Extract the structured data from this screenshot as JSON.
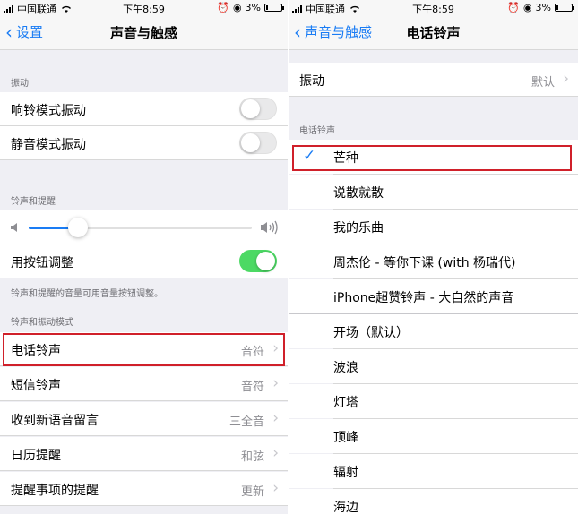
{
  "status": {
    "carrier": "中国联通",
    "time": "下午8:59",
    "battery": "3%"
  },
  "left": {
    "back_label": "设置",
    "title": "声音与触感",
    "vibration_header": "振动",
    "vibration_rows": [
      {
        "label": "响铃模式振动",
        "on": false
      },
      {
        "label": "静音模式振动",
        "on": false
      }
    ],
    "ringer_header": "铃声和提醒",
    "volume_level": 0.22,
    "buttons_row": {
      "label": "用按钮调整",
      "on": true
    },
    "buttons_footer": "铃声和提醒的音量可用音量按钮调整。",
    "patterns_header": "铃声和振动模式",
    "patterns": [
      {
        "label": "电话铃声",
        "value": "音符"
      },
      {
        "label": "短信铃声",
        "value": "音符"
      },
      {
        "label": "收到新语音留言",
        "value": "三全音"
      },
      {
        "label": "日历提醒",
        "value": "和弦"
      },
      {
        "label": "提醒事项的提醒",
        "value": "更新"
      }
    ]
  },
  "right": {
    "back_label": "声音与触感",
    "title": "电话铃声",
    "vibration_row": {
      "label": "振动",
      "value": "默认"
    },
    "ringtones_header": "电话铃声",
    "custom_tones": [
      "芒种",
      "说散就散",
      "我的乐曲",
      "周杰伦 - 等你下课 (with 杨瑞代)",
      "iPhone超赞铃声 - 大自然的声音"
    ],
    "selected_tone": "芒种",
    "builtin_tones": [
      "开场（默认）",
      "波浪",
      "灯塔",
      "顶峰",
      "辐射",
      "海边"
    ]
  },
  "colors": {
    "accent": "#1a7cf4",
    "toggle_on": "#4cd964",
    "highlight": "#d0202a",
    "background": "#efeff4"
  }
}
